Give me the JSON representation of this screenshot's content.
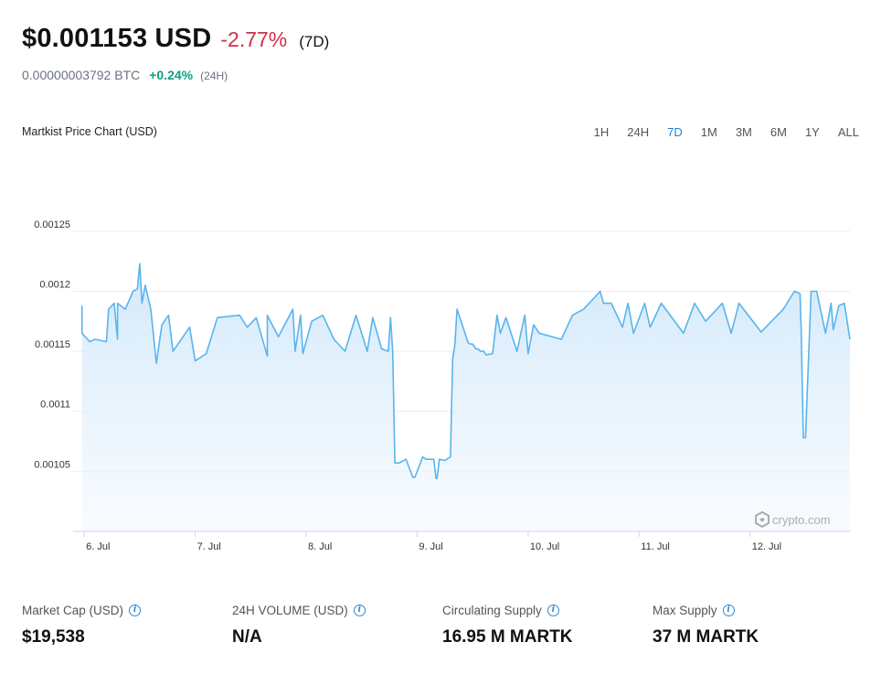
{
  "header": {
    "price": "$0.001153 USD",
    "change": "-2.77%",
    "period": "(7D)",
    "btc_price": "0.00000003792 BTC",
    "btc_change": "+0.24%",
    "btc_period": "(24H)"
  },
  "chart_header": {
    "title": "Martkist Price Chart (USD)",
    "ranges": [
      "1H",
      "24H",
      "7D",
      "1M",
      "3M",
      "6M",
      "1Y",
      "ALL"
    ],
    "active_range": "7D"
  },
  "watermark": "crypto.com",
  "colors": {
    "line": "#5ab4ec",
    "fill": "#d7ecfb",
    "negative": "#cf304a",
    "positive": "#0aa37f",
    "accent": "#1f7fd0"
  },
  "chart_data": {
    "type": "area",
    "title": "Martkist Price Chart (USD)",
    "xlabel": "",
    "ylabel": "",
    "ylim": [
      1.0,
      1.275
    ],
    "y_unit": "USD (x 0.001)",
    "yticks": [
      {
        "value": 1.05,
        "label": "0.00105"
      },
      {
        "value": 1.1,
        "label": "0.0011"
      },
      {
        "value": 1.15,
        "label": "0.00115"
      },
      {
        "value": 1.2,
        "label": "0.0012"
      },
      {
        "value": 1.25,
        "label": "0.00125"
      }
    ],
    "xlim": [
      -0.1,
      6.9
    ],
    "xticks": [
      {
        "value": 0,
        "label": "6. Jul"
      },
      {
        "value": 1,
        "label": "7. Jul"
      },
      {
        "value": 2,
        "label": "8. Jul"
      },
      {
        "value": 3,
        "label": "9. Jul"
      },
      {
        "value": 4,
        "label": "10. Jul"
      },
      {
        "value": 5,
        "label": "11. Jul"
      },
      {
        "value": 6,
        "label": "12. Jul"
      }
    ],
    "grid": true,
    "legend": "none",
    "x": [
      -0.02,
      -0.02,
      0.05,
      0.1,
      0.2,
      0.22,
      0.27,
      0.3,
      0.3,
      0.37,
      0.44,
      0.48,
      0.5,
      0.52,
      0.55,
      0.6,
      0.65,
      0.7,
      0.76,
      0.8,
      0.95,
      1.0,
      1.1,
      1.2,
      1.4,
      1.47,
      1.55,
      1.65,
      1.65,
      1.75,
      1.88,
      1.9,
      1.95,
      1.97,
      2.05,
      2.15,
      2.25,
      2.35,
      2.45,
      2.55,
      2.6,
      2.68,
      2.74,
      2.76,
      2.78,
      2.8,
      2.84,
      2.9,
      2.96,
      2.98,
      3.05,
      3.08,
      3.15,
      3.17,
      3.18,
      3.2,
      3.25,
      3.3,
      3.32,
      3.34,
      3.36,
      3.46,
      3.48,
      3.5,
      3.53,
      3.55,
      3.57,
      3.6,
      3.62,
      3.68,
      3.72,
      3.75,
      3.8,
      3.9,
      3.97,
      4.0,
      4.05,
      4.1,
      4.3,
      4.4,
      4.5,
      4.65,
      4.68,
      4.75,
      4.85,
      4.9,
      4.95,
      5.05,
      5.1,
      5.2,
      5.4,
      5.5,
      5.6,
      5.75,
      5.83,
      5.9,
      6.1,
      6.3,
      6.4,
      6.45,
      6.46,
      6.48,
      6.5,
      6.55,
      6.6,
      6.68,
      6.73,
      6.75,
      6.8,
      6.85,
      6.9
    ],
    "values": [
      1.188,
      1.165,
      1.158,
      1.16,
      1.158,
      1.185,
      1.19,
      1.16,
      1.19,
      1.185,
      1.2,
      1.202,
      1.223,
      1.19,
      1.205,
      1.185,
      1.14,
      1.172,
      1.18,
      1.15,
      1.17,
      1.142,
      1.148,
      1.178,
      1.18,
      1.17,
      1.178,
      1.146,
      1.18,
      1.162,
      1.185,
      1.15,
      1.18,
      1.148,
      1.175,
      1.18,
      1.16,
      1.15,
      1.18,
      1.15,
      1.178,
      1.152,
      1.15,
      1.178,
      1.15,
      1.057,
      1.057,
      1.06,
      1.045,
      1.045,
      1.062,
      1.06,
      1.06,
      1.044,
      1.044,
      1.06,
      1.059,
      1.062,
      1.144,
      1.155,
      1.185,
      1.157,
      1.156,
      1.156,
      1.152,
      1.152,
      1.15,
      1.15,
      1.147,
      1.148,
      1.18,
      1.165,
      1.178,
      1.15,
      1.18,
      1.148,
      1.172,
      1.165,
      1.16,
      1.18,
      1.185,
      1.2,
      1.19,
      1.19,
      1.17,
      1.19,
      1.165,
      1.19,
      1.17,
      1.19,
      1.165,
      1.19,
      1.175,
      1.19,
      1.165,
      1.19,
      1.166,
      1.185,
      1.2,
      1.198,
      1.17,
      1.078,
      1.078,
      1.2,
      1.2,
      1.165,
      1.19,
      1.168,
      1.188,
      1.19,
      1.16
    ]
  },
  "stats": [
    {
      "label": "Market Cap (USD)",
      "value": "$19,538"
    },
    {
      "label": "24H VOLUME (USD)",
      "value": "N/A"
    },
    {
      "label": "Circulating Supply",
      "value": "16.95 M MARTK"
    },
    {
      "label": "Max Supply",
      "value": "37 M MARTK"
    }
  ]
}
